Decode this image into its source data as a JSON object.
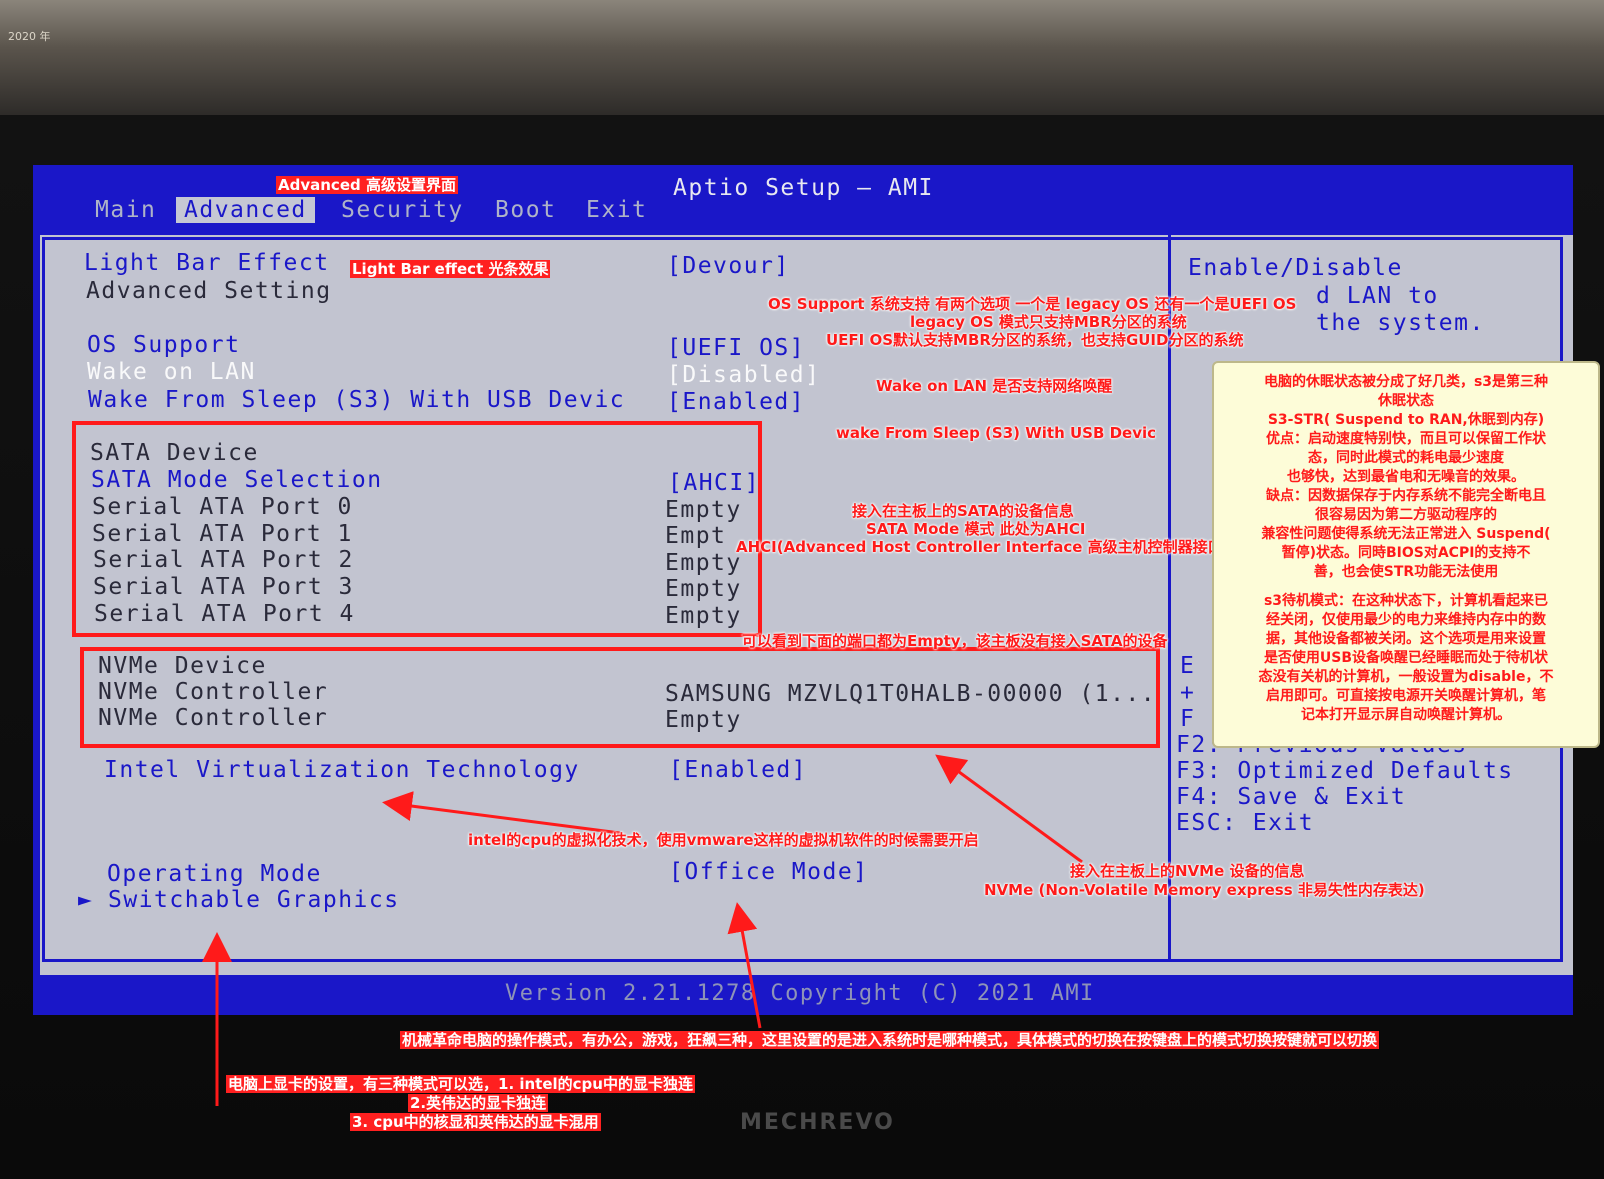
{
  "photo": {
    "desk_stamp": "2020 年",
    "brand": "MECHREVO"
  },
  "bios": {
    "title": "Aptio Setup – AMI",
    "tabs": [
      {
        "label": "Main",
        "active": false
      },
      {
        "label": "Advanced",
        "active": true
      },
      {
        "label": "Security",
        "active": false
      },
      {
        "label": "Boot",
        "active": false
      },
      {
        "label": "Exit",
        "active": false
      }
    ],
    "rows": {
      "light_bar": {
        "label": "Light Bar Effect",
        "value": "[Devour]"
      },
      "advanced_setting": {
        "label": "Advanced Setting"
      },
      "os_support": {
        "label": "OS Support",
        "value": "[UEFI OS]"
      },
      "wake_on_lan": {
        "label": "Wake on LAN",
        "value": "[Disabled]"
      },
      "wake_s3": {
        "label": "Wake From Sleep (S3) With USB Devic",
        "value": "[Enabled]"
      },
      "sata_device": {
        "label": "SATA Device"
      },
      "sata_mode": {
        "label": "SATA Mode Selection",
        "value": "[AHCI]"
      },
      "sata_ports": [
        {
          "label": "Serial ATA Port 0",
          "value": "Empty"
        },
        {
          "label": "Serial ATA Port 1",
          "value": "Empt"
        },
        {
          "label": "Serial ATA Port 2",
          "value": "Empty"
        },
        {
          "label": "Serial ATA Port 3",
          "value": "Empty"
        },
        {
          "label": "Serial ATA Port 4",
          "value": "Empty"
        }
      ],
      "nvme_device": {
        "label": "NVMe Device"
      },
      "nvme_controllers": [
        {
          "label": "NVMe Controller",
          "value": "SAMSUNG MZVLQ1T0HALB-00000 (1..."
        },
        {
          "label": "NVMe Controller",
          "value": "Empty"
        }
      ],
      "vt": {
        "label": "Intel Virtualization Technology",
        "value": "[Enabled]"
      },
      "operating_mode": {
        "label": "Operating Mode",
        "value": "[Office Mode]"
      },
      "switchable": {
        "label": "Switchable Graphics",
        "marker": "►"
      }
    },
    "help": {
      "lines": [
        "Enable/Disable",
        "d LAN to",
        "the system."
      ],
      "keys": [
        "F2: Previous Values",
        "F3: Optimized Defaults",
        "F4: Save & Exit",
        "ESC: Exit"
      ],
      "partial": [
        "E",
        "+",
        "F"
      ]
    },
    "version": "Version 2.21.1278 Copyright (C) 2021 AMI"
  },
  "annotations": {
    "advanced": "Advanced 高级设置界面",
    "light_bar": "Light Bar effect  光条效果",
    "os_support_1": "OS Support 系统支持  有两个选项 一个是  legacy OS    还有一个是UEFI OS",
    "os_support_2": "legacy OS  模式只支持MBR分区的系统",
    "os_support_3": "UEFI OS默认支持MBR分区的系统，也支持GUID分区的系统",
    "wake_lan": "Wake on LAN 是否支持网络唤醒",
    "wake_s3": "wake From Sleep (S3)  With USB Devic",
    "sata_1": "接入在主板上的SATA的设备信息",
    "sata_2": "SATA Mode 模式 此处为AHCI",
    "sata_3": "AHCI(Advanced Host Controller Interface 高级主机控制器接口)",
    "sata_empty": "可以看到下面的端口都为Empty，该主板没有接入SATA的设备",
    "vt": "intel的cpu的虚拟化技术，使用vmware这样的虚拟机软件的时候需要开启",
    "nvme_1": "接入在主板上的NVMe 设备的信息",
    "nvme_2": "NVMe (Non-Volatile Memory express  非易失性内存表达)",
    "op_mode": "机械革命电脑的操作模式，有办公，游戏，狂飙三种，这里设置的是进入系统时是哪种模式，具体模式的切换在按键盘上的模式切换按键就可以切换",
    "graphics_1": "电脑上显卡的设置，有三种模式可以选，1. intel的cpu中的显卡独连",
    "graphics_2": "2.英伟达的显卡独连",
    "graphics_3": "3. cpu中的核显和英伟达的显卡混用",
    "note": [
      "电脑的休眠状态被分成了好几类，s3是第三种",
      "休眠状态",
      "S3-STR( Suspend to RAN,休眠到内存)",
      "优点：启动速度特别快，而且可以保留工作状",
      "态，同时此模式的耗电最少速度",
      "也够快，达到最省电和无噪音的效果。",
      "缺点：因数据保存于内存系统不能完全断电且",
      "很容易因为第二方驱动程序的",
      "兼容性问题使得系统无法正常进入 Suspend(",
      "暂停)状态。同時BIOS对ACPI的支持不",
      "善，也会使STR功能无法使用",
      "",
      "s3待机模式：在这种状态下，计算机看起来已",
      "经关闭，仅使用最少的电力来维持内存中的数",
      "据，其他设备都被关闭。这个选项是用来设置",
      "是否使用USB设备唤醒已经睡眠而处于待机状",
      "态没有关机的计算机，一般设置为disable，不",
      "启用即可。可直接按电源开关唤醒计算机，笔",
      "记本打开显示屏自动唤醒计算机。"
    ]
  }
}
